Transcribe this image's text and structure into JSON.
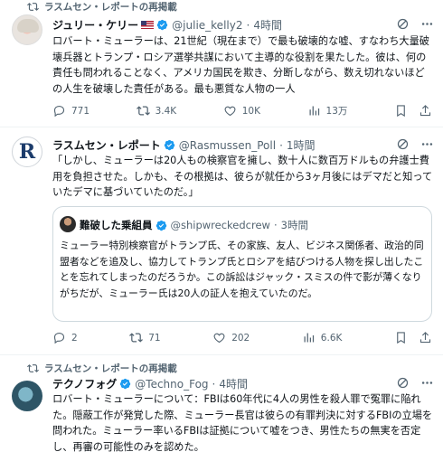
{
  "posts": [
    {
      "repost_label": "ラスムセン・レポートの再掲載",
      "author_name": "ジュリー・ケリー",
      "handle": "@julie_kelly2",
      "time": "4時間",
      "text": "ロバート・ミューラーは、21世紀（現在まで）で最も破壊的な嘘、すなわち大量破壊兵器とトランプ・ロシア選挙共謀において主導的な役割を果たした。彼は、何の責任も問われることなく、アメリカ国民を欺き、分断しながら、数え切れないほどの人生を破壊した責任がある。最も悪質な人物の一人",
      "replies": "771",
      "reposts": "3.4K",
      "likes": "10K",
      "views": "13万"
    },
    {
      "author_name": "ラスムセン・レポート",
      "handle": "@Rasmussen_Poll",
      "time": "1時間",
      "text": "「しかし、ミューラーは20人もの検察官を擁し、数十人に数百万ドルもの弁護士費用を負担させた。しかも、その根拠は、彼らが就任から3ヶ月後にはデマだと知っていたデマに基づいていたのだ。」",
      "quote": {
        "author_name": "難破した乗組員",
        "handle": "@shipwreckedcrew",
        "time": "3時間",
        "text": "ミューラー特別検察官がトランプ氏、その家族、友人、ビジネス関係者、政治的同盟者などを追及し、協力してトランプ氏とロシアを結びつける人物を探し出したことを忘れてしまったのだろうか。この訴訟はジャック・スミスの件で影が薄くなりがちだが、ミューラー氏は20人の証人を抱えていたのだ。"
      },
      "replies": "2",
      "reposts": "71",
      "likes": "202",
      "views": "6.6K"
    },
    {
      "repost_label": "ラスムセン・レポートの再掲載",
      "author_name": "テクノフォグ",
      "handle": "@Techno_Fog",
      "time": "4時間",
      "text": "ロバート・ミューラーについて：FBIは60年代に4人の男性を殺人罪で冤罪に陥れた。隠蔽工作が発覚した際、ミューラー長官は彼らの有罪判決に対するFBIの立場を問われた。ミューラー率いるFBIは証拠について嘘をつき、男性たちの無実を否定し、再審の可能性のみを認めた。"
    }
  ],
  "colors": {
    "verified": "#1d9bf0",
    "secondary": "#536471"
  }
}
